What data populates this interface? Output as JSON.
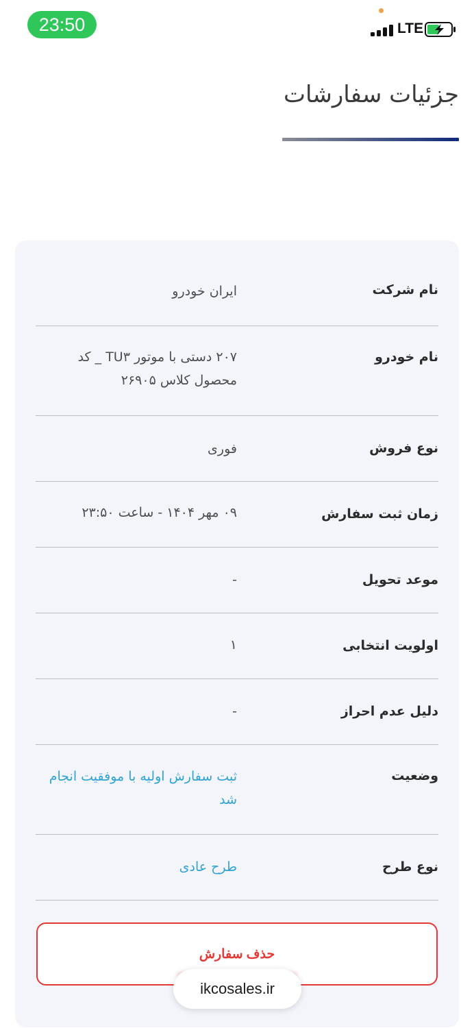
{
  "status_bar": {
    "time": "23:50",
    "network": "LTE"
  },
  "header": {
    "title": "جزئیات سفارشات"
  },
  "details": [
    {
      "label": "نام شرکت",
      "value": "ایران خودرو"
    },
    {
      "label": "نام خودرو",
      "value": "۲۰۷ دستی با موتور TU۳ _ کد محصول کلاس ۲۶۹۰۵"
    },
    {
      "label": "نوع فروش",
      "value": "فوری"
    },
    {
      "label": "زمان ثبت سفارش",
      "value": "۰۹ مهر ۱۴۰۴ - ساعت ۲۳:۵۰"
    },
    {
      "label": "موعد تحویل",
      "value": "-"
    },
    {
      "label": "اولویت انتخابی",
      "value": "۱"
    },
    {
      "label": "دلیل عدم احراز",
      "value": "-"
    },
    {
      "label": "وضعیت",
      "value": "ثبت سفارش اولیه با موفقیت انجام شد"
    },
    {
      "label": "نوع طرح",
      "value": "طرح عادی"
    }
  ],
  "actions": {
    "delete_label": "حذف سفارش"
  },
  "browser": {
    "url": "ikcosales.ir"
  },
  "colors": {
    "time_pill": "#30c75a",
    "accent_blue": "#2fa2d6",
    "danger": "#e53935",
    "underline_end": "#0f2a7a"
  }
}
